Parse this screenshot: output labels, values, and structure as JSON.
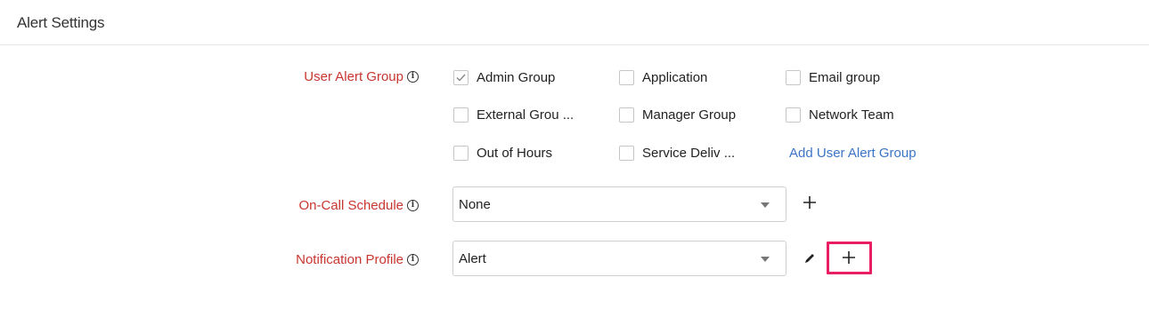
{
  "section": {
    "title": "Alert Settings"
  },
  "user_alert_group": {
    "label": "User Alert Group",
    "options": [
      {
        "label": "Admin Group",
        "checked": true
      },
      {
        "label": "Application",
        "checked": false
      },
      {
        "label": "Email group",
        "checked": false
      },
      {
        "label": "External Grou ...",
        "checked": false
      },
      {
        "label": "Manager Group",
        "checked": false
      },
      {
        "label": "Network Team",
        "checked": false
      },
      {
        "label": "Out of Hours",
        "checked": false
      },
      {
        "label": "Service Deliv ...",
        "checked": false
      }
    ],
    "add_link": "Add User Alert Group"
  },
  "on_call_schedule": {
    "label": "On-Call Schedule",
    "selected": "None"
  },
  "notification_profile": {
    "label": "Notification Profile",
    "selected": "Alert"
  },
  "icons": {
    "info": "info-icon",
    "add": "plus-icon",
    "edit": "pencil-icon",
    "dropdown": "caret-down-icon"
  },
  "colors": {
    "label_red": "#c8362f",
    "link_blue": "#3c74c7",
    "highlight": "#e91e63"
  }
}
